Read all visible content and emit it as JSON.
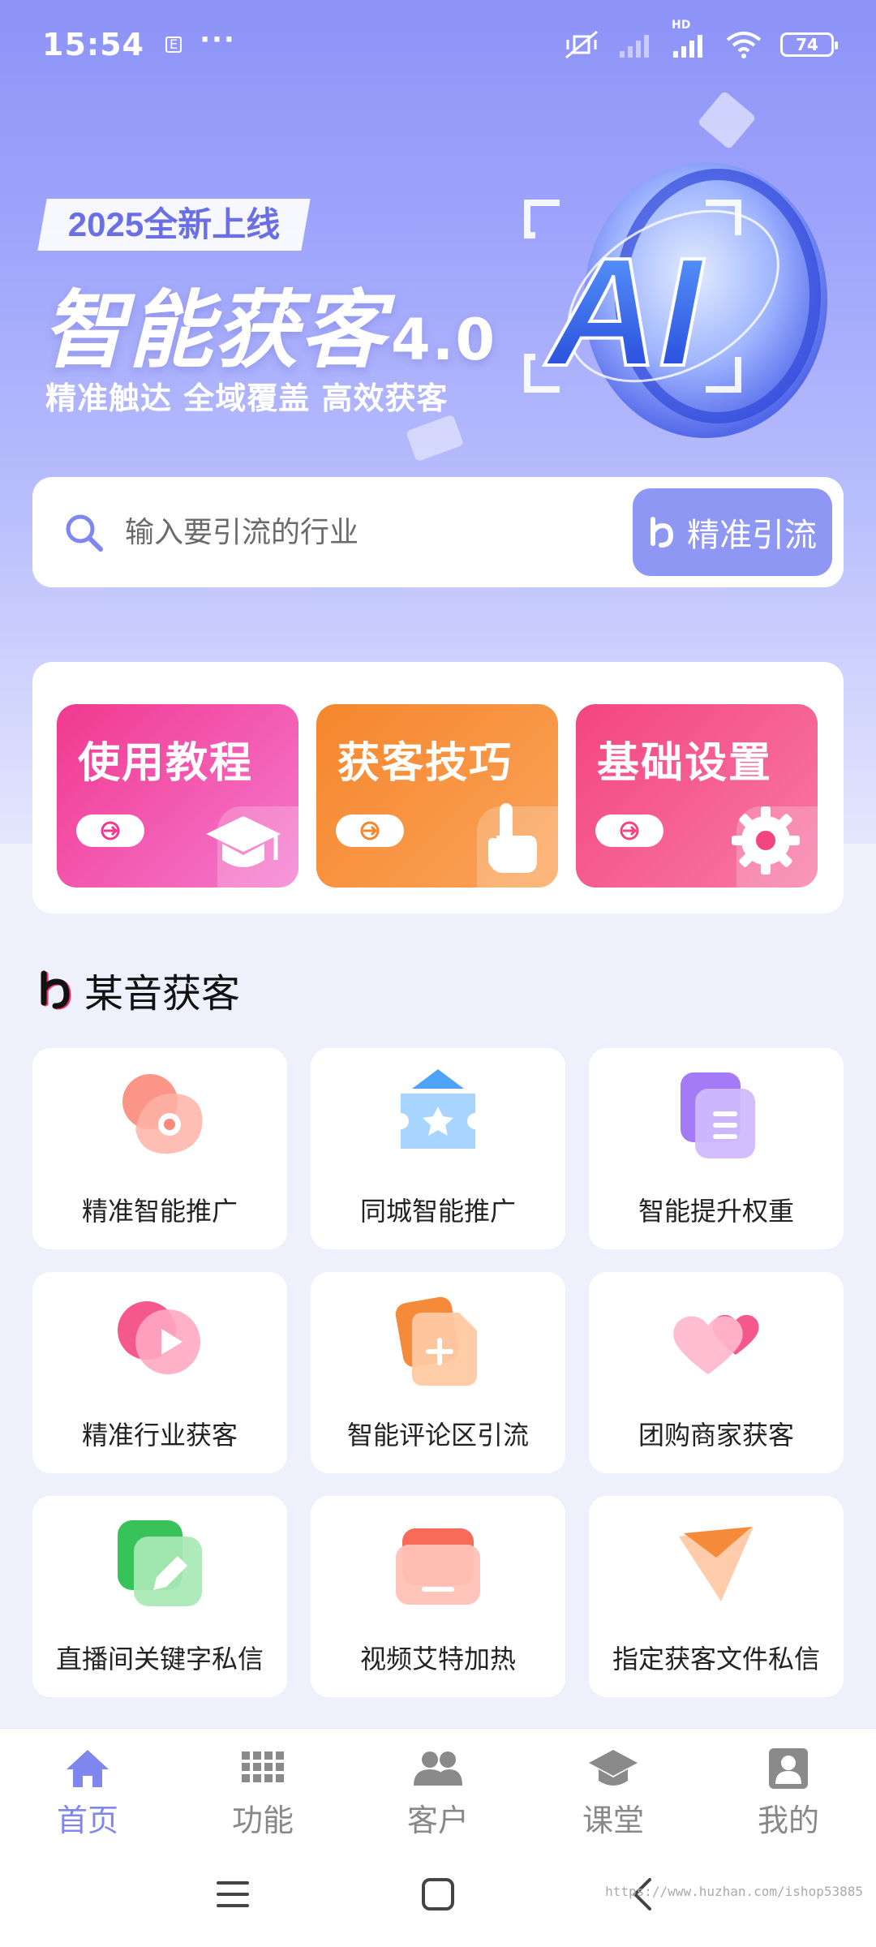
{
  "status_bar": {
    "time": "15:54",
    "network": "HD",
    "battery": "74"
  },
  "hero": {
    "tag": "2025全新上线",
    "title": "智能获客",
    "version": "4.0",
    "subtitle": "精准触达 全域覆盖 高效获客",
    "badge_text": "AI"
  },
  "search": {
    "placeholder": "输入要引流的行业",
    "button_label": "精准引流"
  },
  "quick_cards": [
    {
      "label": "使用教程",
      "icon": "graduation-cap-icon",
      "color_from": "#f0398f",
      "color_to": "#f57ad0"
    },
    {
      "label": "获客技巧",
      "icon": "tap-hand-icon",
      "color_from": "#f5862c",
      "color_to": "#fba35a"
    },
    {
      "label": "基础设置",
      "icon": "gear-icon",
      "color_from": "#f3457f",
      "color_to": "#f87aa5"
    }
  ],
  "section": {
    "title": "某音获客"
  },
  "features": [
    {
      "label": "精准智能推广",
      "icon": "target-icon"
    },
    {
      "label": "同城智能推广",
      "icon": "ticket-star-icon"
    },
    {
      "label": "智能提升权重",
      "icon": "document-icon"
    },
    {
      "label": "精准行业获客",
      "icon": "play-icon"
    },
    {
      "label": "智能评论区引流",
      "icon": "file-plus-icon"
    },
    {
      "label": "团购商家获客",
      "icon": "heart-icon"
    },
    {
      "label": "直播间关键字私信",
      "icon": "edit-icon"
    },
    {
      "label": "视频艾特加热",
      "icon": "folder-icon"
    },
    {
      "label": "指定获客文件私信",
      "icon": "send-icon"
    }
  ],
  "tabs": [
    {
      "label": "首页",
      "icon": "home-icon",
      "active": true
    },
    {
      "label": "功能",
      "icon": "grid-icon",
      "active": false
    },
    {
      "label": "客户",
      "icon": "users-icon",
      "active": false
    },
    {
      "label": "课堂",
      "icon": "classroom-icon",
      "active": false
    },
    {
      "label": "我的",
      "icon": "profile-icon",
      "active": false
    }
  ],
  "watermark": "https://www.huzhan.com/ishop53885",
  "colors": {
    "accent": "#7f86ee",
    "button": "#8f97f5"
  }
}
